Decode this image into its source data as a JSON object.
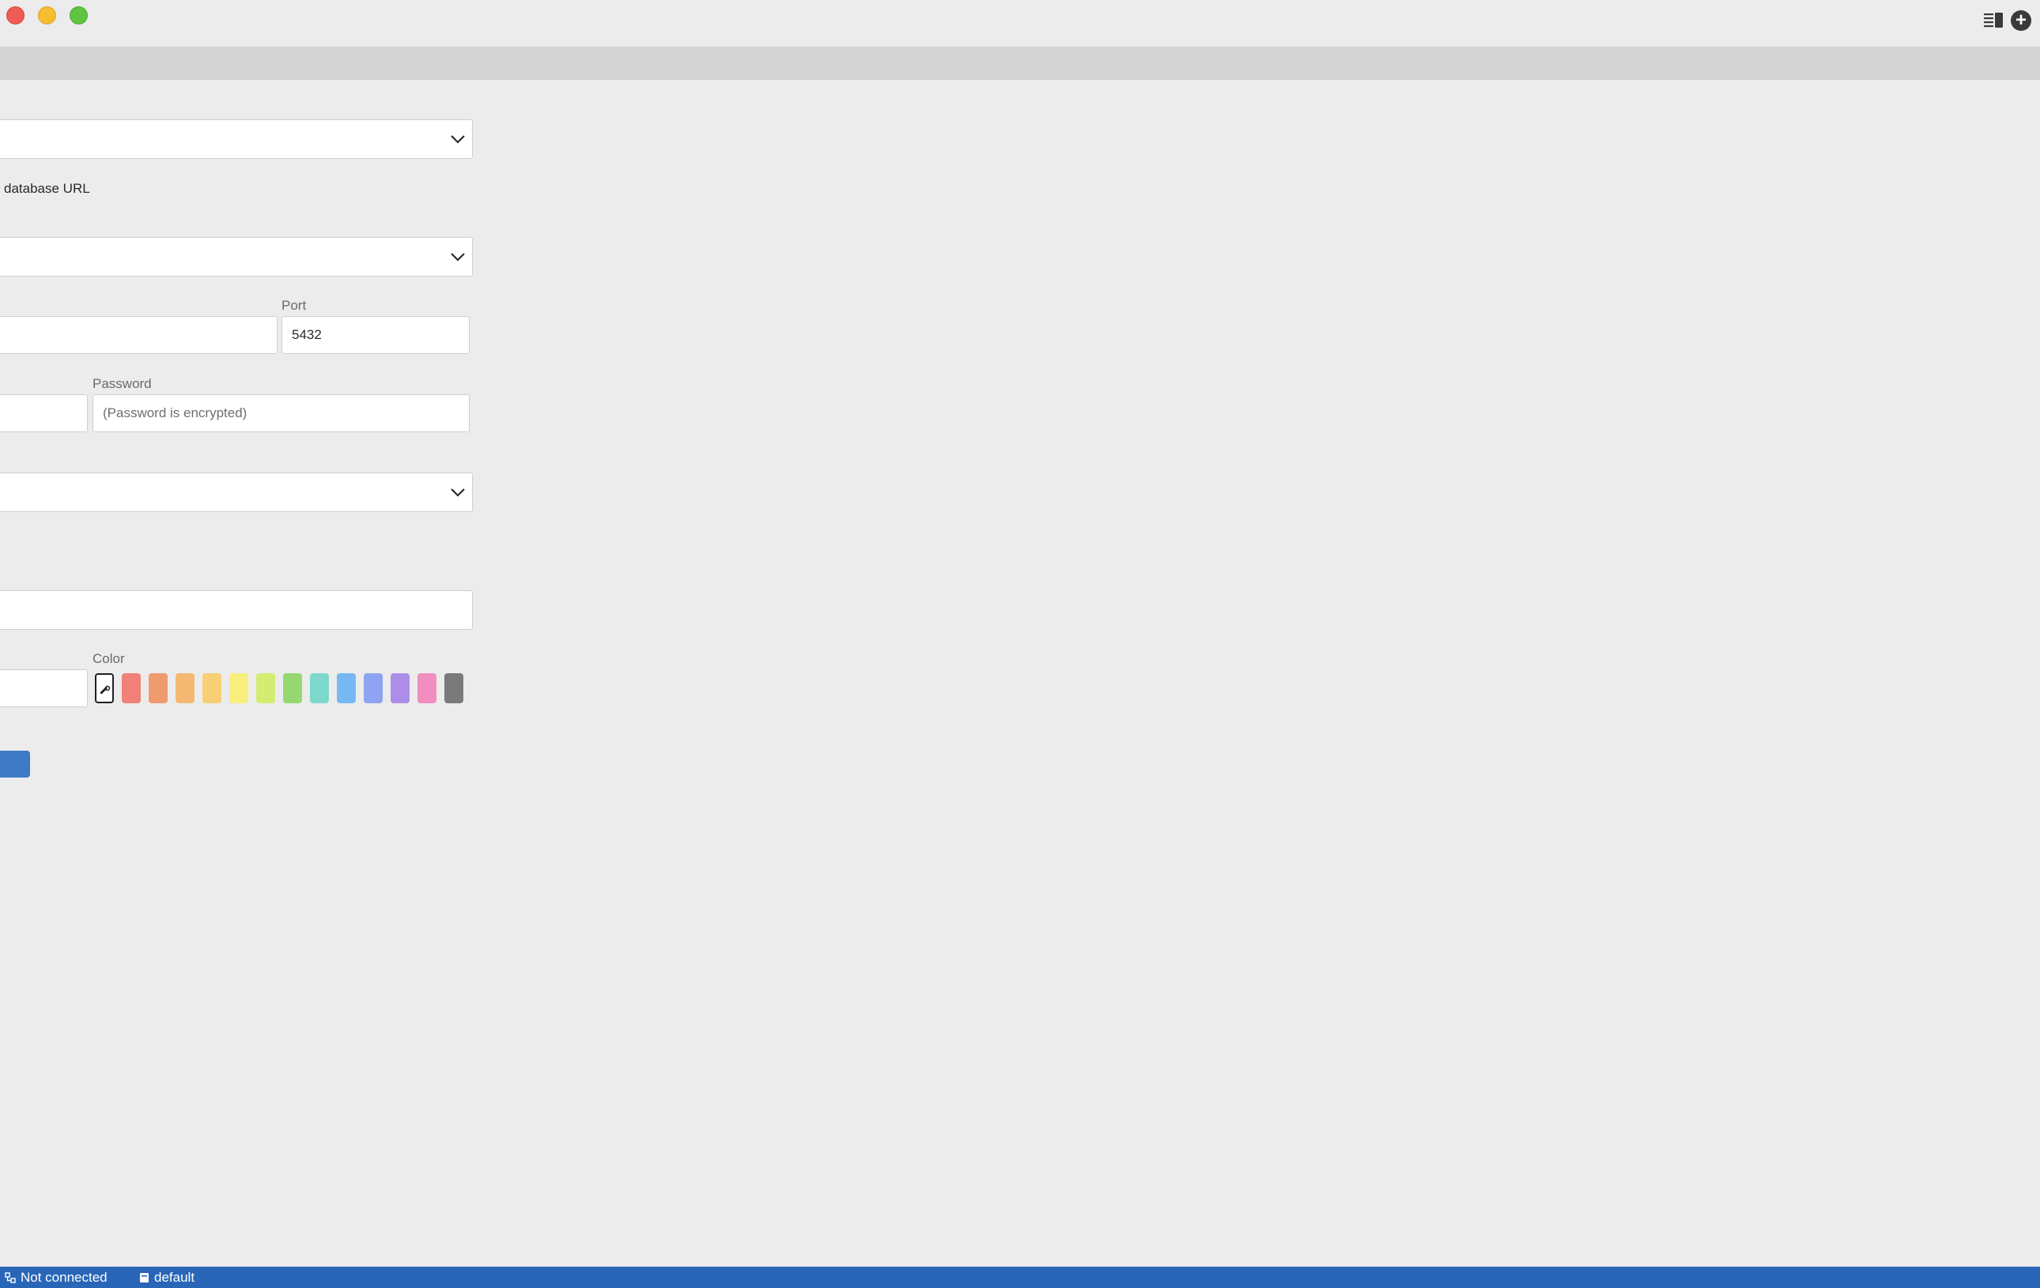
{
  "form": {
    "url_hint": "database URL",
    "port_label": "Port",
    "port_value": "5432",
    "password_label": "Password",
    "password_placeholder": "(Password is encrypted)",
    "color_label": "Color"
  },
  "swatches": [
    "#f08078",
    "#f09a70",
    "#f5b872",
    "#f7cf74",
    "#f8ef7c",
    "#d4ec72",
    "#96d870",
    "#7ed8cc",
    "#78b8f2",
    "#8ea4f2",
    "#ac8ee8",
    "#f08ec0",
    "#7a7a7a"
  ],
  "statusbar": {
    "connection": "Not connected",
    "workspace": "default"
  },
  "icons": {
    "sidebar": "sidebar-toggle-icon",
    "add": "plus-icon",
    "chevron": "chevron-down-icon",
    "network": "network-icon",
    "database": "database-icon",
    "eyedropper": "eyedropper-icon"
  },
  "colors": {
    "accent": "#2966b8",
    "button": "#3e7bc4"
  }
}
